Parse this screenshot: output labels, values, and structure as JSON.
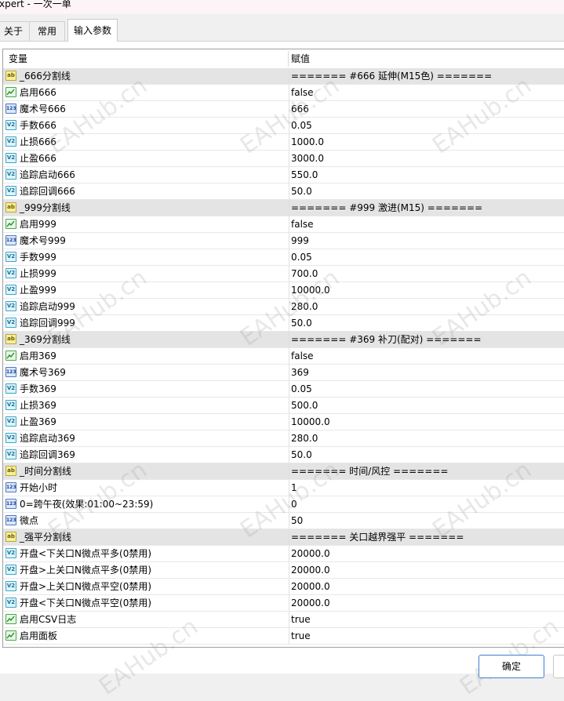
{
  "window": {
    "title": "xpert - 一次一单"
  },
  "tabs": [
    {
      "label": "关于"
    },
    {
      "label": "常用"
    },
    {
      "label": "输入参数"
    }
  ],
  "table": {
    "headers": {
      "variable": "变量",
      "value": "赋值"
    },
    "rows": [
      {
        "icon": "string-icon",
        "group": true,
        "name": "_666分割线",
        "value": "======= #666 延伸(M15色) ======="
      },
      {
        "icon": "bool-icon",
        "group": false,
        "name": "启用666",
        "value": "false"
      },
      {
        "icon": "int-icon",
        "group": false,
        "name": "魔术号666",
        "value": "666"
      },
      {
        "icon": "double-icon",
        "group": false,
        "name": "手数666",
        "value": "0.05"
      },
      {
        "icon": "double-icon",
        "group": false,
        "name": "止损666",
        "value": "1000.0"
      },
      {
        "icon": "double-icon",
        "group": false,
        "name": "止盈666",
        "value": "3000.0"
      },
      {
        "icon": "double-icon",
        "group": false,
        "name": "追踪启动666",
        "value": "550.0"
      },
      {
        "icon": "double-icon",
        "group": false,
        "name": "追踪回调666",
        "value": "50.0"
      },
      {
        "icon": "string-icon",
        "group": true,
        "name": "_999分割线",
        "value": "======= #999 激进(M15) ======="
      },
      {
        "icon": "bool-icon",
        "group": false,
        "name": "启用999",
        "value": "false"
      },
      {
        "icon": "int-icon",
        "group": false,
        "name": "魔术号999",
        "value": "999"
      },
      {
        "icon": "double-icon",
        "group": false,
        "name": "手数999",
        "value": "0.05"
      },
      {
        "icon": "double-icon",
        "group": false,
        "name": "止损999",
        "value": "700.0"
      },
      {
        "icon": "double-icon",
        "group": false,
        "name": "止盈999",
        "value": "10000.0"
      },
      {
        "icon": "double-icon",
        "group": false,
        "name": "追踪启动999",
        "value": "280.0"
      },
      {
        "icon": "double-icon",
        "group": false,
        "name": "追踪回调999",
        "value": "50.0"
      },
      {
        "icon": "string-icon",
        "group": true,
        "name": "_369分割线",
        "value": "======= #369 补刀(配对) ======="
      },
      {
        "icon": "bool-icon",
        "group": false,
        "name": "启用369",
        "value": "false"
      },
      {
        "icon": "int-icon",
        "group": false,
        "name": "魔术号369",
        "value": "369"
      },
      {
        "icon": "double-icon",
        "group": false,
        "name": "手数369",
        "value": "0.05"
      },
      {
        "icon": "double-icon",
        "group": false,
        "name": "止损369",
        "value": "500.0"
      },
      {
        "icon": "double-icon",
        "group": false,
        "name": "止盈369",
        "value": "10000.0"
      },
      {
        "icon": "double-icon",
        "group": false,
        "name": "追踪启动369",
        "value": "280.0"
      },
      {
        "icon": "double-icon",
        "group": false,
        "name": "追踪回调369",
        "value": "50.0"
      },
      {
        "icon": "string-icon",
        "group": true,
        "name": "_时间分割线",
        "value": "======= 时间/风控 ======="
      },
      {
        "icon": "int-icon",
        "group": false,
        "name": "开始小时",
        "value": "1"
      },
      {
        "icon": "int-icon",
        "group": false,
        "name": "0=跨午夜(效果:01:00~23:59)",
        "value": "0"
      },
      {
        "icon": "int-icon",
        "group": false,
        "name": "微点",
        "value": "50"
      },
      {
        "icon": "string-icon",
        "group": true,
        "name": "_强平分割线",
        "value": "======= 关口越界强平 ======="
      },
      {
        "icon": "double-icon",
        "group": false,
        "name": "开盘<下关口N微点平多(0禁用)",
        "value": "20000.0"
      },
      {
        "icon": "double-icon",
        "group": false,
        "name": "开盘>上关口N微点平多(0禁用)",
        "value": "20000.0"
      },
      {
        "icon": "double-icon",
        "group": false,
        "name": "开盘>上关口N微点平空(0禁用)",
        "value": "20000.0"
      },
      {
        "icon": "double-icon",
        "group": false,
        "name": "开盘<下关口N微点平空(0禁用)",
        "value": "20000.0"
      },
      {
        "icon": "bool-icon",
        "group": false,
        "name": "启用CSV日志",
        "value": "true"
      },
      {
        "icon": "bool-icon",
        "group": false,
        "name": "启用面板",
        "value": "true"
      }
    ]
  },
  "icon_glyphs": {
    "string-icon": "ab",
    "int-icon": "123",
    "double-icon": "V2"
  },
  "buttons": {
    "ok_label": "确定"
  },
  "watermark": {
    "text": "EAHub.cn"
  },
  "colors": {
    "accent": "#3c7fd5",
    "group_row": "#e4e4e4"
  }
}
